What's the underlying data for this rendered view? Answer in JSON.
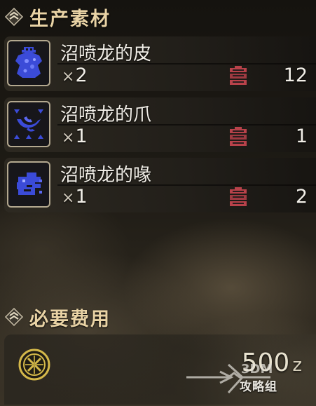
{
  "sections": {
    "materials_title": "生产素材",
    "fees_title": "必要费用"
  },
  "materials": [
    {
      "name": "沼喷龙的皮",
      "qty_prefix": "×",
      "qty": "2",
      "stock": "12",
      "icon": "hide-icon"
    },
    {
      "name": "沼喷龙的爪",
      "qty_prefix": "×",
      "qty": "1",
      "stock": "1",
      "icon": "claw-icon"
    },
    {
      "name": "沼喷龙的喙",
      "qty_prefix": "×",
      "qty": "1",
      "stock": "2",
      "icon": "beak-icon"
    }
  ],
  "fee": {
    "amount": "500",
    "unit": "z",
    "icon": "zenny-coin-icon"
  },
  "watermark": {
    "text": "攻略组",
    "logo_text": "3DM"
  },
  "colors": {
    "heading": "#e9d3a5",
    "item_icon_blue": "#3b4bd8",
    "item_box_red": "#b8424a",
    "coin_gold": "#d4b84a"
  }
}
